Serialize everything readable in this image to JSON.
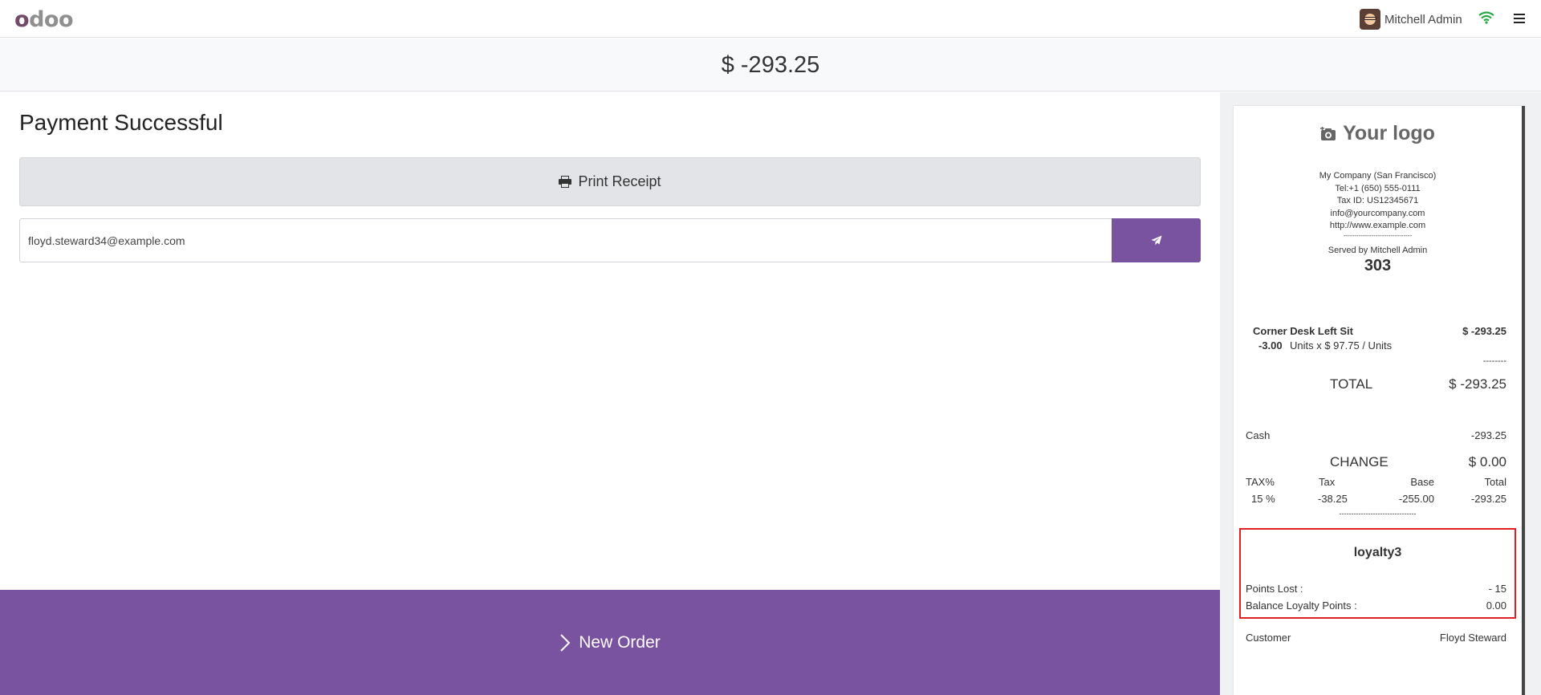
{
  "topbar": {
    "logo_first": "o",
    "logo_rest": "doo",
    "user_name": "Mitchell Admin"
  },
  "amount_due": "$ -293.25",
  "payment": {
    "title": "Payment Successful",
    "print_label": "Print Receipt",
    "email_value": "floyd.steward34@example.com",
    "new_order_label": "New Order"
  },
  "receipt": {
    "logo_text": "Your logo",
    "company_lines": [
      "My Company (San Francisco)",
      "Tel:+1 (650) 555-0111",
      "Tax ID: US12345671",
      "info@yourcompany.com",
      "http://www.example.com",
      "--------------------------------"
    ],
    "served_by": "Served by Mitchell Admin",
    "order_number": "303",
    "line": {
      "product": "Corner Desk Left Sit",
      "price": "$ -293.25",
      "qty": "-3.00",
      "detail": "Units x $ 97.75 / Units"
    },
    "separator": "--------",
    "total_label": "TOTAL",
    "total_value": "$ -293.25",
    "payment_method": "Cash",
    "payment_amount": "-293.25",
    "change_label": "CHANGE",
    "change_value": "$ 0.00",
    "tax_headers": [
      "TAX%",
      "Tax",
      "Base",
      "Total"
    ],
    "tax_row": [
      "15 %",
      "-38.25",
      "-255.00",
      "-293.25"
    ],
    "tax_separator": "--------------------------------",
    "loyalty": {
      "name": "loyalty3",
      "points_lost_label": "Points Lost :",
      "points_lost_value": "- 15",
      "balance_label": "Balance Loyalty Points :",
      "balance_value": "0.00"
    },
    "customer_label": "Customer",
    "customer_value": "Floyd Steward"
  }
}
